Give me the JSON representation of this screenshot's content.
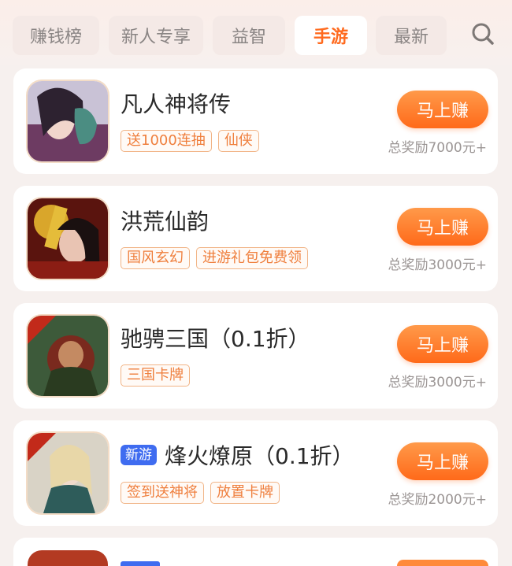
{
  "tabs": [
    {
      "label": "赚钱榜",
      "active": false
    },
    {
      "label": "新人专享",
      "active": false
    },
    {
      "label": "益智",
      "active": false
    },
    {
      "label": "手游",
      "active": true
    },
    {
      "label": "最新",
      "active": false
    }
  ],
  "search_icon": "search-icon",
  "accent_color": "#ff6a1e",
  "games": [
    {
      "title": "凡人神将传",
      "new_badge": "",
      "tags": [
        "送1000连抽",
        "仙侠"
      ],
      "button": "马上赚",
      "reward": "总奖励7000元+"
    },
    {
      "title": "洪荒仙韵",
      "new_badge": "",
      "tags": [
        "国风玄幻",
        "进游礼包免费领"
      ],
      "button": "马上赚",
      "reward": "总奖励3000元+"
    },
    {
      "title": "驰骋三国（0.1折）",
      "new_badge": "",
      "tags": [
        "三国卡牌"
      ],
      "button": "马上赚",
      "reward": "总奖励3000元+"
    },
    {
      "title": "烽火燎原（0.1折）",
      "new_badge": "新游",
      "tags": [
        "签到送神将",
        "放置卡牌"
      ],
      "button": "马上赚",
      "reward": "总奖励2000元+"
    }
  ]
}
